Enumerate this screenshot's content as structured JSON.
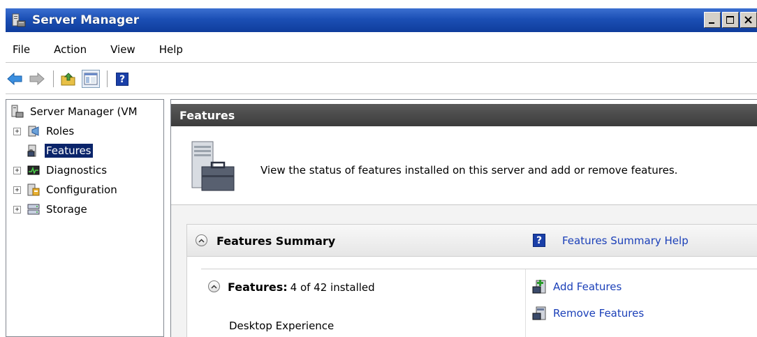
{
  "window": {
    "title": "Server Manager",
    "icon": "server-manager-icon",
    "controls": [
      "minimize",
      "maximize",
      "close"
    ]
  },
  "menu": {
    "items": [
      {
        "label": "File"
      },
      {
        "label": "Action"
      },
      {
        "label": "View"
      },
      {
        "label": "Help"
      }
    ]
  },
  "toolbar": {
    "buttons": [
      "back-arrow-icon",
      "forward-arrow-icon",
      "up-folder-icon",
      "show-hide-console-tree-icon",
      "help-icon"
    ],
    "help_glyph": "?"
  },
  "tree": {
    "root_label": "Server Manager (VM",
    "items": [
      {
        "label": "Roles",
        "expandable": true,
        "icon": "roles-icon"
      },
      {
        "label": "Features",
        "expandable": false,
        "selected": true,
        "icon": "features-icon"
      },
      {
        "label": "Diagnostics",
        "expandable": true,
        "icon": "diagnostics-icon"
      },
      {
        "label": "Configuration",
        "expandable": true,
        "icon": "configuration-icon"
      },
      {
        "label": "Storage",
        "expandable": true,
        "icon": "storage-icon"
      }
    ],
    "expander_glyph": "+"
  },
  "content": {
    "header": "Features",
    "intro_text": "View the status of features installed on this server and add or remove features.",
    "summary": {
      "title": "Features Summary",
      "help_link": "Features Summary Help",
      "help_glyph": "?",
      "features_label": "Features:",
      "features_count": "4 of 42 installed",
      "actions": [
        {
          "label": "Add Features",
          "icon": "add-features-icon"
        },
        {
          "label": "Remove Features",
          "icon": "remove-features-icon"
        }
      ],
      "installed": [
        "Desktop Experience"
      ]
    }
  },
  "colors": {
    "titlebar": "#1b4fb5",
    "header": "#3c3c3c",
    "link": "#1a3fb8",
    "selection": "#0a246a"
  }
}
